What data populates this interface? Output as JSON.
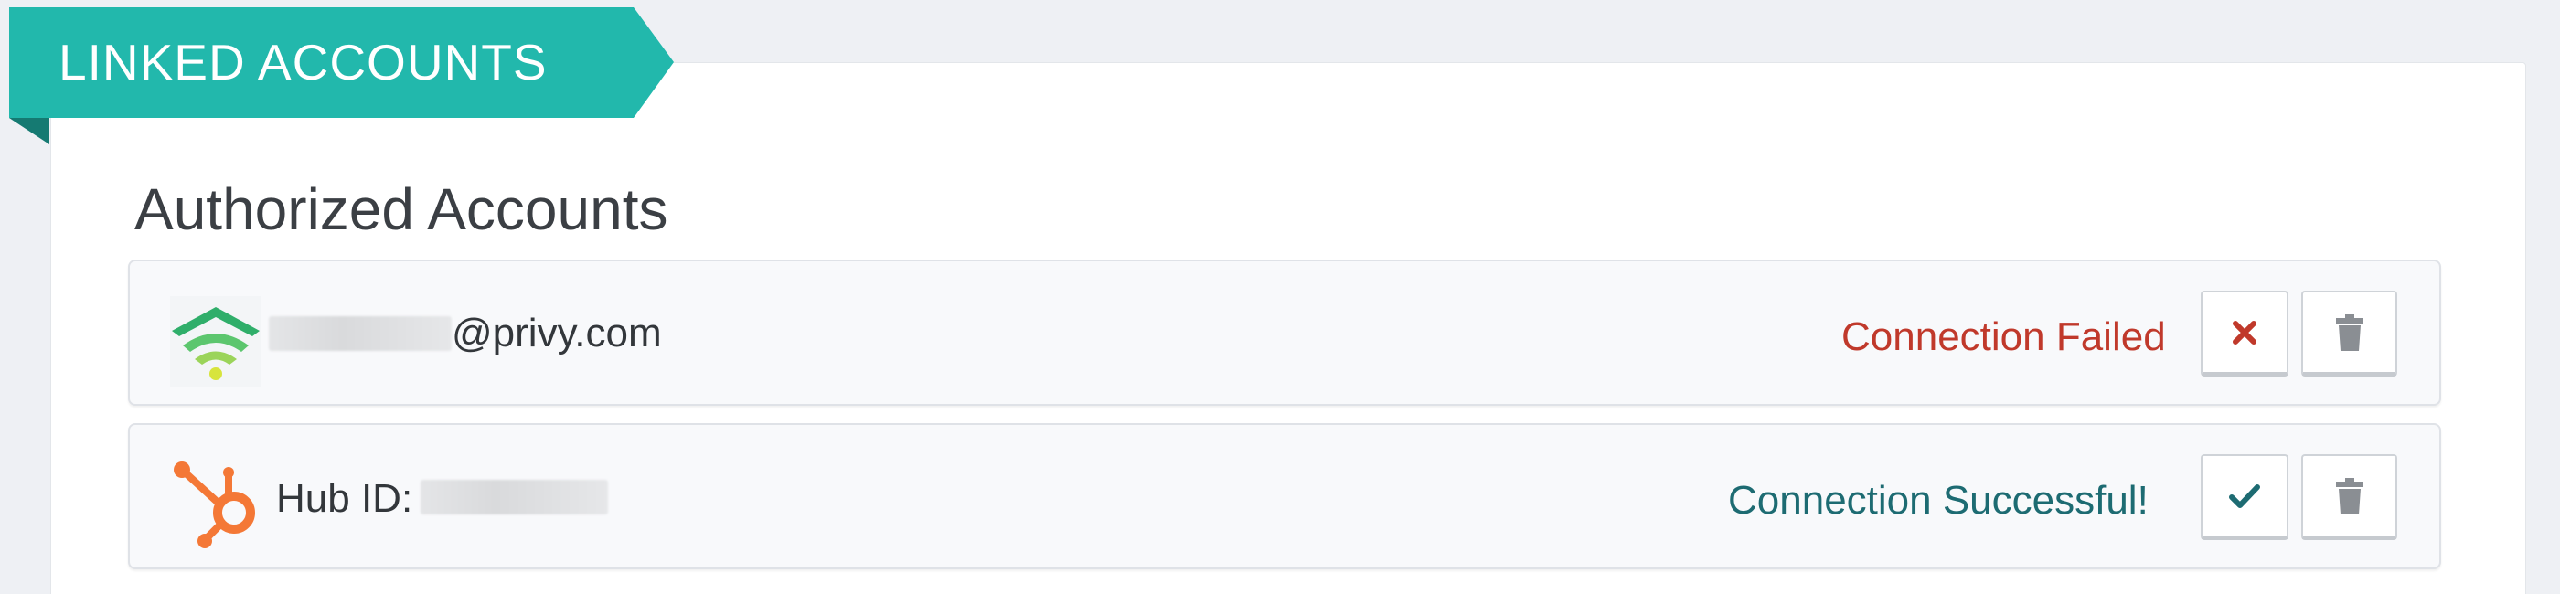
{
  "header": {
    "ribbon_label": "LINKED ACCOUNTS"
  },
  "section": {
    "title": "Authorized Accounts"
  },
  "accounts": [
    {
      "logo_icon": "privy-wifi-logo-icon",
      "prefix": "",
      "identifier_suffix": "@privy.com",
      "status_text": "Connection Failed",
      "status_color": "#c0392b",
      "status_icon": "x-icon",
      "delete_icon": "trash-icon"
    },
    {
      "logo_icon": "hubspot-sprocket-logo-icon",
      "prefix": "Hub ID:",
      "identifier_suffix": "",
      "status_text": "Connection Successful!",
      "status_color": "#1d6b72",
      "status_icon": "checkmark-icon",
      "delete_icon": "trash-icon"
    }
  ],
  "colors": {
    "ribbon": "#22b8ac",
    "ribbon_fold": "#157a72",
    "failed": "#c0392b",
    "success": "#1d6b72",
    "hubspot_orange": "#f47836"
  }
}
